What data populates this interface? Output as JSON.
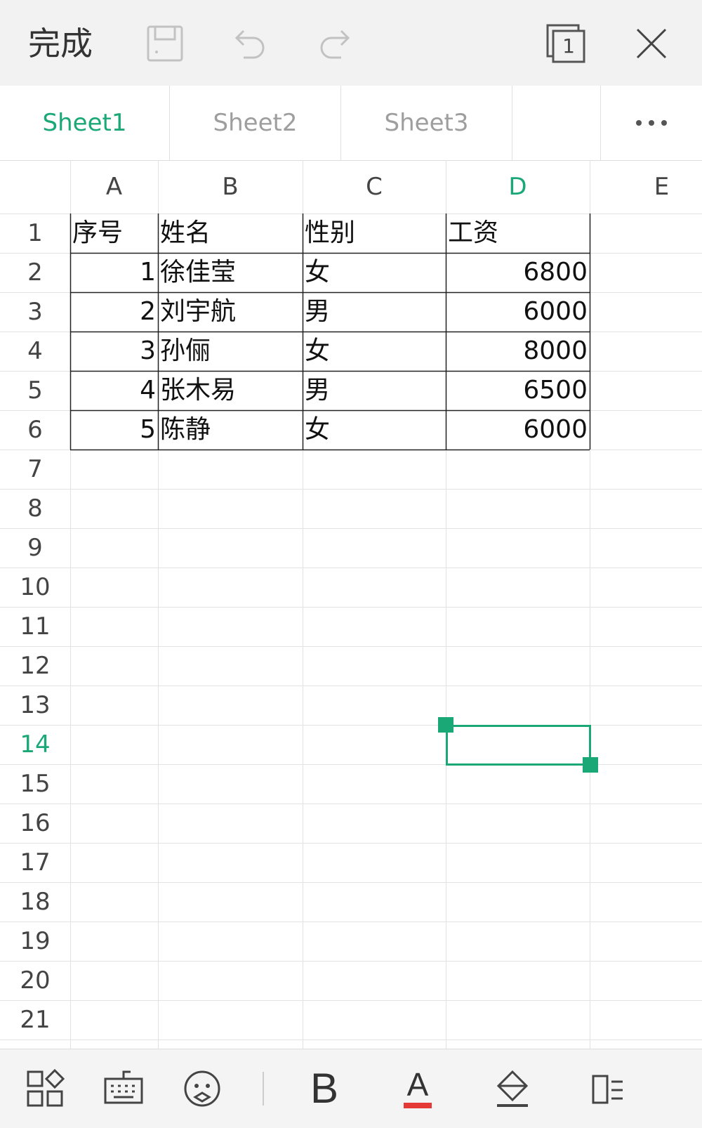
{
  "toolbar": {
    "done_label": "完成",
    "icons": [
      "save-icon",
      "undo-icon",
      "redo-icon",
      "sheet-count-icon",
      "close-icon"
    ],
    "sheet_count": "1"
  },
  "tabs": [
    {
      "label": "Sheet1",
      "active": true
    },
    {
      "label": "Sheet2",
      "active": false
    },
    {
      "label": "Sheet3",
      "active": false
    }
  ],
  "columns": [
    "A",
    "B",
    "C",
    "D",
    "E"
  ],
  "selected_column": "D",
  "rows": [
    "1",
    "2",
    "3",
    "4",
    "5",
    "6",
    "7",
    "8",
    "9",
    "10",
    "11",
    "12",
    "13",
    "14",
    "15",
    "16",
    "17",
    "18",
    "19",
    "20",
    "21"
  ],
  "selected_row": "14",
  "table": {
    "headers": [
      "序号",
      "姓名",
      "性别",
      "工资"
    ],
    "records": [
      [
        "1",
        "徐佳莹",
        "女",
        "6800"
      ],
      [
        "2",
        "刘宇航",
        "男",
        "6000"
      ],
      [
        "3",
        "孙俪",
        "女",
        "8000"
      ],
      [
        "4",
        "张木易",
        "男",
        "6500"
      ],
      [
        "5",
        "陈静",
        "女",
        "6000"
      ]
    ]
  },
  "selected_cell": "D14",
  "colors": {
    "accent": "#1ba877",
    "font_color_underline": "#e53935"
  },
  "bottombar": {
    "bold_label": "B",
    "font_color_label": "A",
    "icons": [
      "apps-grid-icon",
      "keyboard-icon",
      "emoji-icon",
      "bold-icon",
      "font-color-icon",
      "fill-color-icon",
      "wrap-icon"
    ]
  }
}
